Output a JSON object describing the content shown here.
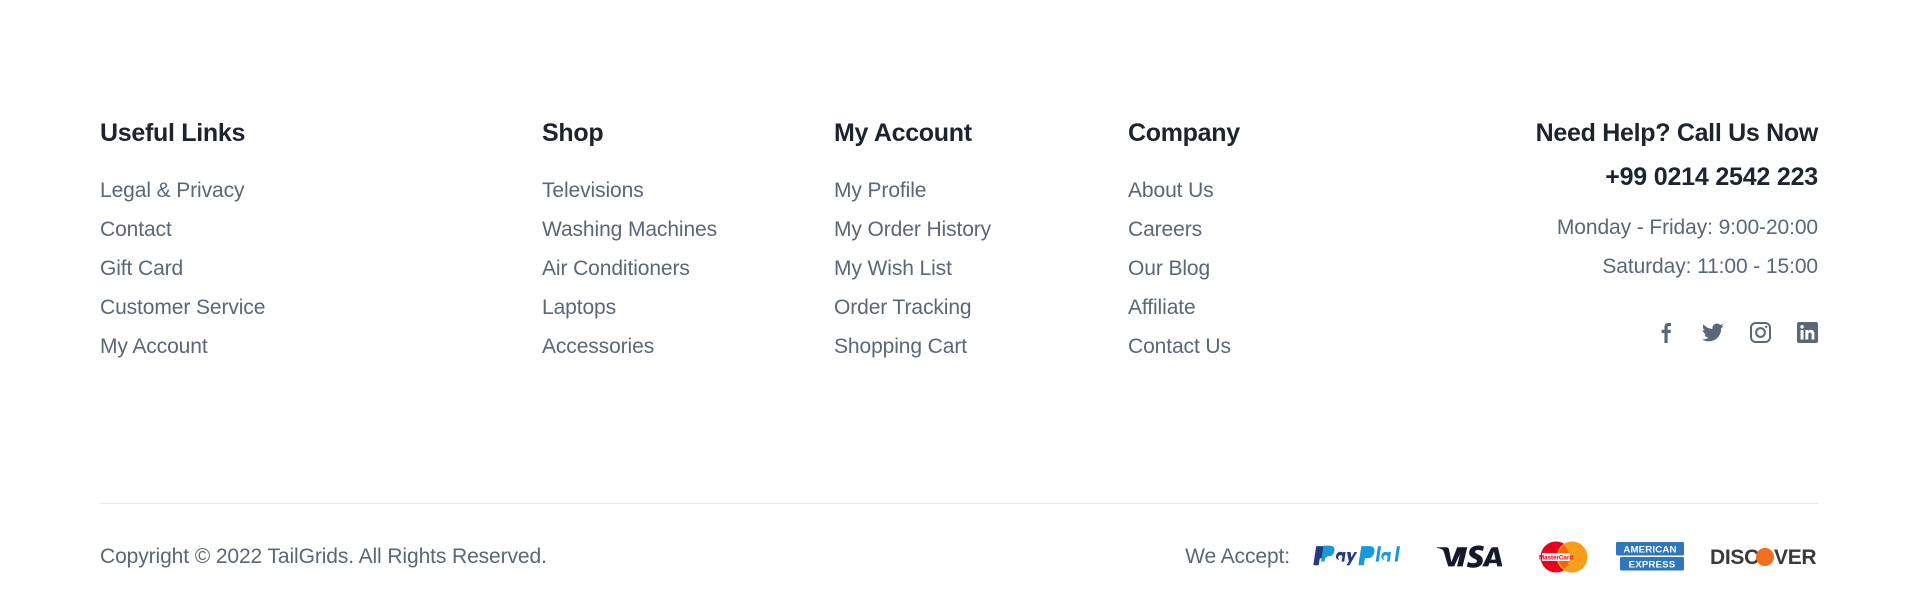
{
  "footer": {
    "columns": [
      {
        "title": "Useful Links",
        "items": [
          "Legal & Privacy",
          "Contact",
          "Gift Card",
          "Customer Service",
          "My Account"
        ]
      },
      {
        "title": "Shop",
        "items": [
          "Televisions",
          "Washing Machines",
          "Air Conditioners",
          "Laptops",
          "Accessories"
        ]
      },
      {
        "title": "My Account",
        "items": [
          "My Profile",
          "My Order History",
          "My Wish List",
          "Order Tracking",
          "Shopping Cart"
        ]
      },
      {
        "title": "Company",
        "items": [
          "About Us",
          "Careers",
          "Our Blog",
          "Affiliate",
          "Contact Us"
        ]
      }
    ],
    "help": {
      "title": "Need Help? Call Us Now",
      "phone": "+99 0214 2542 223",
      "hours_weekday": "Monday - Friday: 9:00-20:00",
      "hours_saturday": "Saturday: 11:00 - 15:00",
      "socials": [
        {
          "name": "facebook-icon",
          "label": "Facebook"
        },
        {
          "name": "twitter-icon",
          "label": "Twitter"
        },
        {
          "name": "instagram-icon",
          "label": "Instagram"
        },
        {
          "name": "linkedin-icon",
          "label": "LinkedIn"
        }
      ]
    },
    "bottom": {
      "copyright": "Copyright © 2022 TailGrids. All Rights Reserved.",
      "we_accept_label": "We Accept:",
      "payment_methods": [
        {
          "name": "paypal-logo",
          "label": "PayPal"
        },
        {
          "name": "visa-logo",
          "label": "VISA"
        },
        {
          "name": "mastercard-logo",
          "label": "MasterCard"
        },
        {
          "name": "amex-logo",
          "label": "AMERICAN EXPRESS"
        },
        {
          "name": "discover-logo",
          "label": "DISCOVER"
        }
      ]
    },
    "colors": {
      "background": "#ffffff",
      "heading": "#1D2430",
      "body_text": "#5A6779",
      "divider": "#E7E7EC",
      "paypal_dark": "#253B80",
      "paypal_light": "#179BD7",
      "visa": "#1A1F36",
      "mastercard_red": "#EB001B",
      "mastercard_orange": "#F79E1B",
      "amex_blue": "#2E77BC",
      "discover_dark": "#3A3A3A",
      "discover_orange": "#F26E21"
    }
  }
}
